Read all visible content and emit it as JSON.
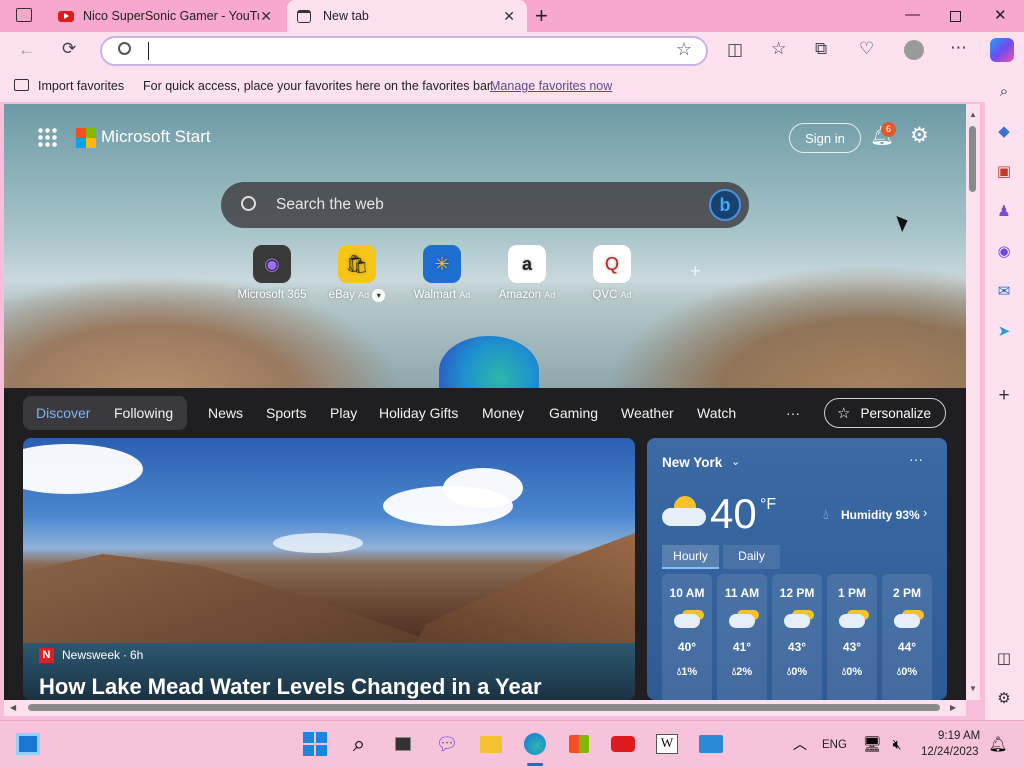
{
  "browser": {
    "tabs": [
      {
        "title": "Nico SuperSonic Gamer - YouTube",
        "icon": "youtube-icon"
      },
      {
        "title": "New tab",
        "icon": "newtab-icon"
      }
    ],
    "address_value": "",
    "favorites_bar": {
      "import_label": "Import favorites",
      "message": "For quick access, place your favorites here on the favorites bar.",
      "manage_link": "Manage favorites now"
    }
  },
  "start": {
    "brand": "Microsoft Start",
    "sign_in": "Sign in",
    "notifications_count": "6",
    "search_placeholder": "Search the web",
    "quick_links": [
      {
        "label": "Microsoft 365",
        "ad": "",
        "icon": "microsoft365-icon"
      },
      {
        "label": "eBay",
        "ad": "Ad",
        "icon": "ebay-icon"
      },
      {
        "label": "Walmart",
        "ad": "Ad",
        "icon": "walmart-icon"
      },
      {
        "label": "Amazon",
        "ad": "Ad",
        "icon": "amazon-icon"
      },
      {
        "label": "QVC",
        "ad": "Ad",
        "icon": "qvc-icon"
      }
    ]
  },
  "feed": {
    "tabs": [
      "Discover",
      "Following",
      "News",
      "Sports",
      "Play",
      "Holiday Gifts",
      "Money",
      "Gaming",
      "Weather",
      "Watch"
    ],
    "more": "···",
    "personalize": "Personalize",
    "article": {
      "source": "Newsweek",
      "age": "6h",
      "headline": "How Lake Mead Water Levels Changed in a Year"
    }
  },
  "weather": {
    "location": "New York",
    "temp": "40",
    "unit": "°F",
    "humidity": "Humidity 93%",
    "tabs": [
      "Hourly",
      "Daily"
    ],
    "hours": [
      {
        "time": "10 AM",
        "temp": "40°",
        "precip": "1%"
      },
      {
        "time": "11 AM",
        "temp": "41°",
        "precip": "2%"
      },
      {
        "time": "12 PM",
        "temp": "43°",
        "precip": "0%"
      },
      {
        "time": "1 PM",
        "temp": "43°",
        "precip": "0%"
      },
      {
        "time": "2 PM",
        "temp": "44°",
        "precip": "0%"
      }
    ]
  },
  "taskbar": {
    "lang": "ENG",
    "time": "9:19 AM",
    "date": "12/24/2023"
  }
}
